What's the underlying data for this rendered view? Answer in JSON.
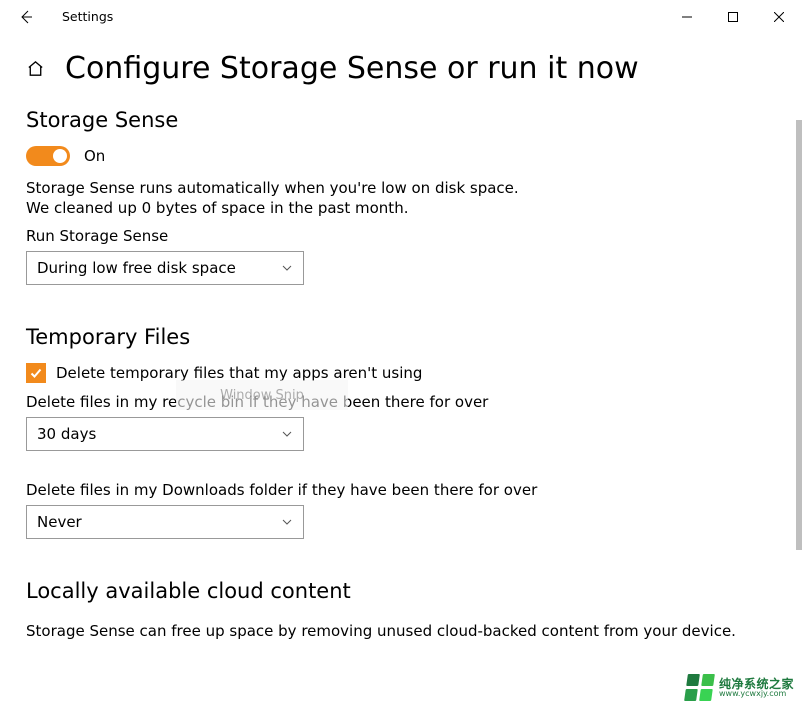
{
  "window": {
    "title": "Settings"
  },
  "header": {
    "page_title": "Configure Storage Sense or run it now"
  },
  "storage_sense": {
    "section_title": "Storage Sense",
    "toggle_state": "On",
    "desc_line1": "Storage Sense runs automatically when you're low on disk space.",
    "desc_line2": "We cleaned up 0 bytes of space in the past month.",
    "run_label": "Run Storage Sense",
    "run_value": "During low free disk space"
  },
  "temp_files": {
    "section_title": "Temporary Files",
    "checkbox_label": "Delete temporary files that my apps aren't using",
    "recycle_label": "Delete files in my recycle bin if they have been there for over",
    "recycle_value": "30 days",
    "downloads_label": "Delete files in my Downloads folder if they have been there for over",
    "downloads_value": "Never"
  },
  "cloud": {
    "section_title": "Locally available cloud content",
    "desc": "Storage Sense can free up space by removing unused cloud-backed content from your device."
  },
  "overlay": {
    "snip_text": "Window Snip"
  },
  "watermark": {
    "line1": "纯净系统之家",
    "line2": "www.ycwxjy.com"
  },
  "accent_color": "#f28a1c"
}
